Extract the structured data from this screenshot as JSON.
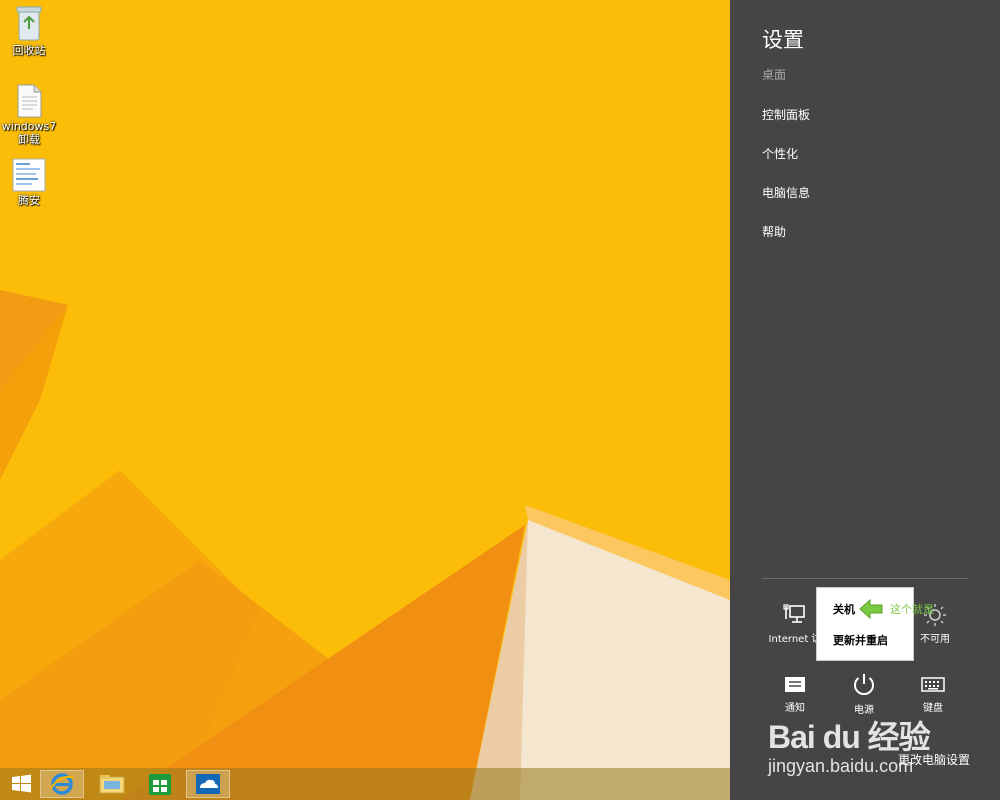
{
  "desktop": {
    "icons": [
      {
        "label": "回收站",
        "icon": "recycle-bin-icon"
      },
      {
        "label": "windows7卸载",
        "icon": "text-document-icon"
      },
      {
        "label": "腾安",
        "icon": "image-document-icon"
      }
    ]
  },
  "taskbar": {
    "buttons": [
      {
        "icon": "windows-start-icon"
      },
      {
        "icon": "internet-explorer-icon"
      },
      {
        "icon": "file-explorer-icon"
      },
      {
        "icon": "store-icon"
      },
      {
        "icon": "onedrive-icon"
      }
    ]
  },
  "charm": {
    "title": "设置",
    "subtitle": "桌面",
    "links": [
      "控制面板",
      "个性化",
      "电脑信息",
      "帮助"
    ],
    "tiles": {
      "network": {
        "label": "Internet 访",
        "icon": "network-icon"
      },
      "brightness": {
        "label": "不可用",
        "icon": "brightness-icon"
      },
      "notifications": {
        "label": "通知",
        "icon": "notifications-icon"
      },
      "power": {
        "label": "电源",
        "icon": "power-icon"
      },
      "keyboard": {
        "label": "键盘",
        "icon": "keyboard-icon"
      }
    },
    "power_menu": {
      "items": [
        "关机",
        "更新并重启"
      ]
    },
    "annotation": {
      "text": "这个就是",
      "icon": "green-arrow-left-icon"
    },
    "change_settings": "更改电脑设置"
  },
  "watermark": {
    "main": "Bai du 经验",
    "sub": "jingyan.baidu.com"
  },
  "colors": {
    "wallpaper": "#fbbd08",
    "charm_bg": "#454545",
    "annotation_green": "#7ac943"
  }
}
